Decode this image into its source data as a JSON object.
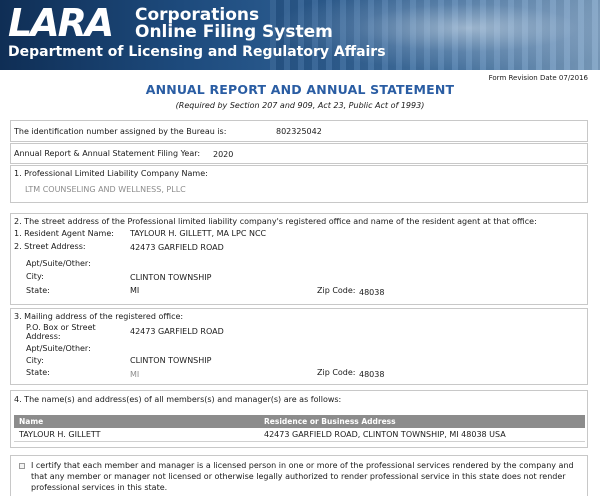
{
  "banner": {
    "logo_text": "LARA",
    "title_line1": "Corporations",
    "title_line2": "Online Filing System",
    "department": "Department of Licensing and Regulatory Affairs"
  },
  "form": {
    "revision": "Form Revision Date 07/2016",
    "title": "ANNUAL REPORT AND ANNUAL STATEMENT",
    "subtitle": "(Required by Section 207 and 909, Act 23, Public Act of 1993)"
  },
  "identification": {
    "label": "The identification number assigned by the Bureau is:",
    "value": "802325042"
  },
  "filing_year": {
    "label": "Annual Report & Annual Statement Filing Year:",
    "value": "2020"
  },
  "company": {
    "label": "1. Professional Limited Liability Company Name:",
    "value": "LTM COUNSELING AND WELLNESS, PLLC"
  },
  "registered_office": {
    "heading": "2. The street address of the Professional limited liability company's registered office and name of the resident agent at that office:",
    "agent_label": "1. Resident Agent Name:",
    "agent_value": "TAYLOUR H. GILLETT, MA LPC NCC",
    "street_label": "2. Street Address:",
    "street_value": "42473 GARFIELD ROAD",
    "apt_label": "Apt/Suite/Other:",
    "city_label": "City:",
    "city_value": "CLINTON TOWNSHIP",
    "state_label": "State:",
    "state_value": "MI",
    "zip_label": "Zip Code:",
    "zip_value": "48038"
  },
  "mailing": {
    "heading": "3. Mailing address of the registered office:",
    "pobox_label_1": "P.O. Box or Street",
    "pobox_label_2": "Address:",
    "pobox_value": "42473 GARFIELD ROAD",
    "apt_label": "Apt/Suite/Other:",
    "city_label": "City:",
    "city_value": "CLINTON TOWNSHIP",
    "state_label": "State:",
    "state_value": "MI",
    "zip_label": "Zip Code:",
    "zip_value": "48038"
  },
  "members": {
    "heading": "4. The name(s) and address(es) of all members(s) and manager(s) are as follows:",
    "columns": [
      "Name",
      "Residence or Business Address"
    ],
    "rows": [
      [
        "TAYLOUR H. GILLETT",
        "42473 GARFIELD ROAD, CLINTON TOWNSHIP, MI 48038 USA"
      ]
    ]
  },
  "certification": {
    "text": "I certify that each member and manager is a licensed person in one or more of the professional services rendered by the company and that any member or manager not licensed or otherwise legally authorized to render professional service in this state does not render professional services in this state."
  }
}
